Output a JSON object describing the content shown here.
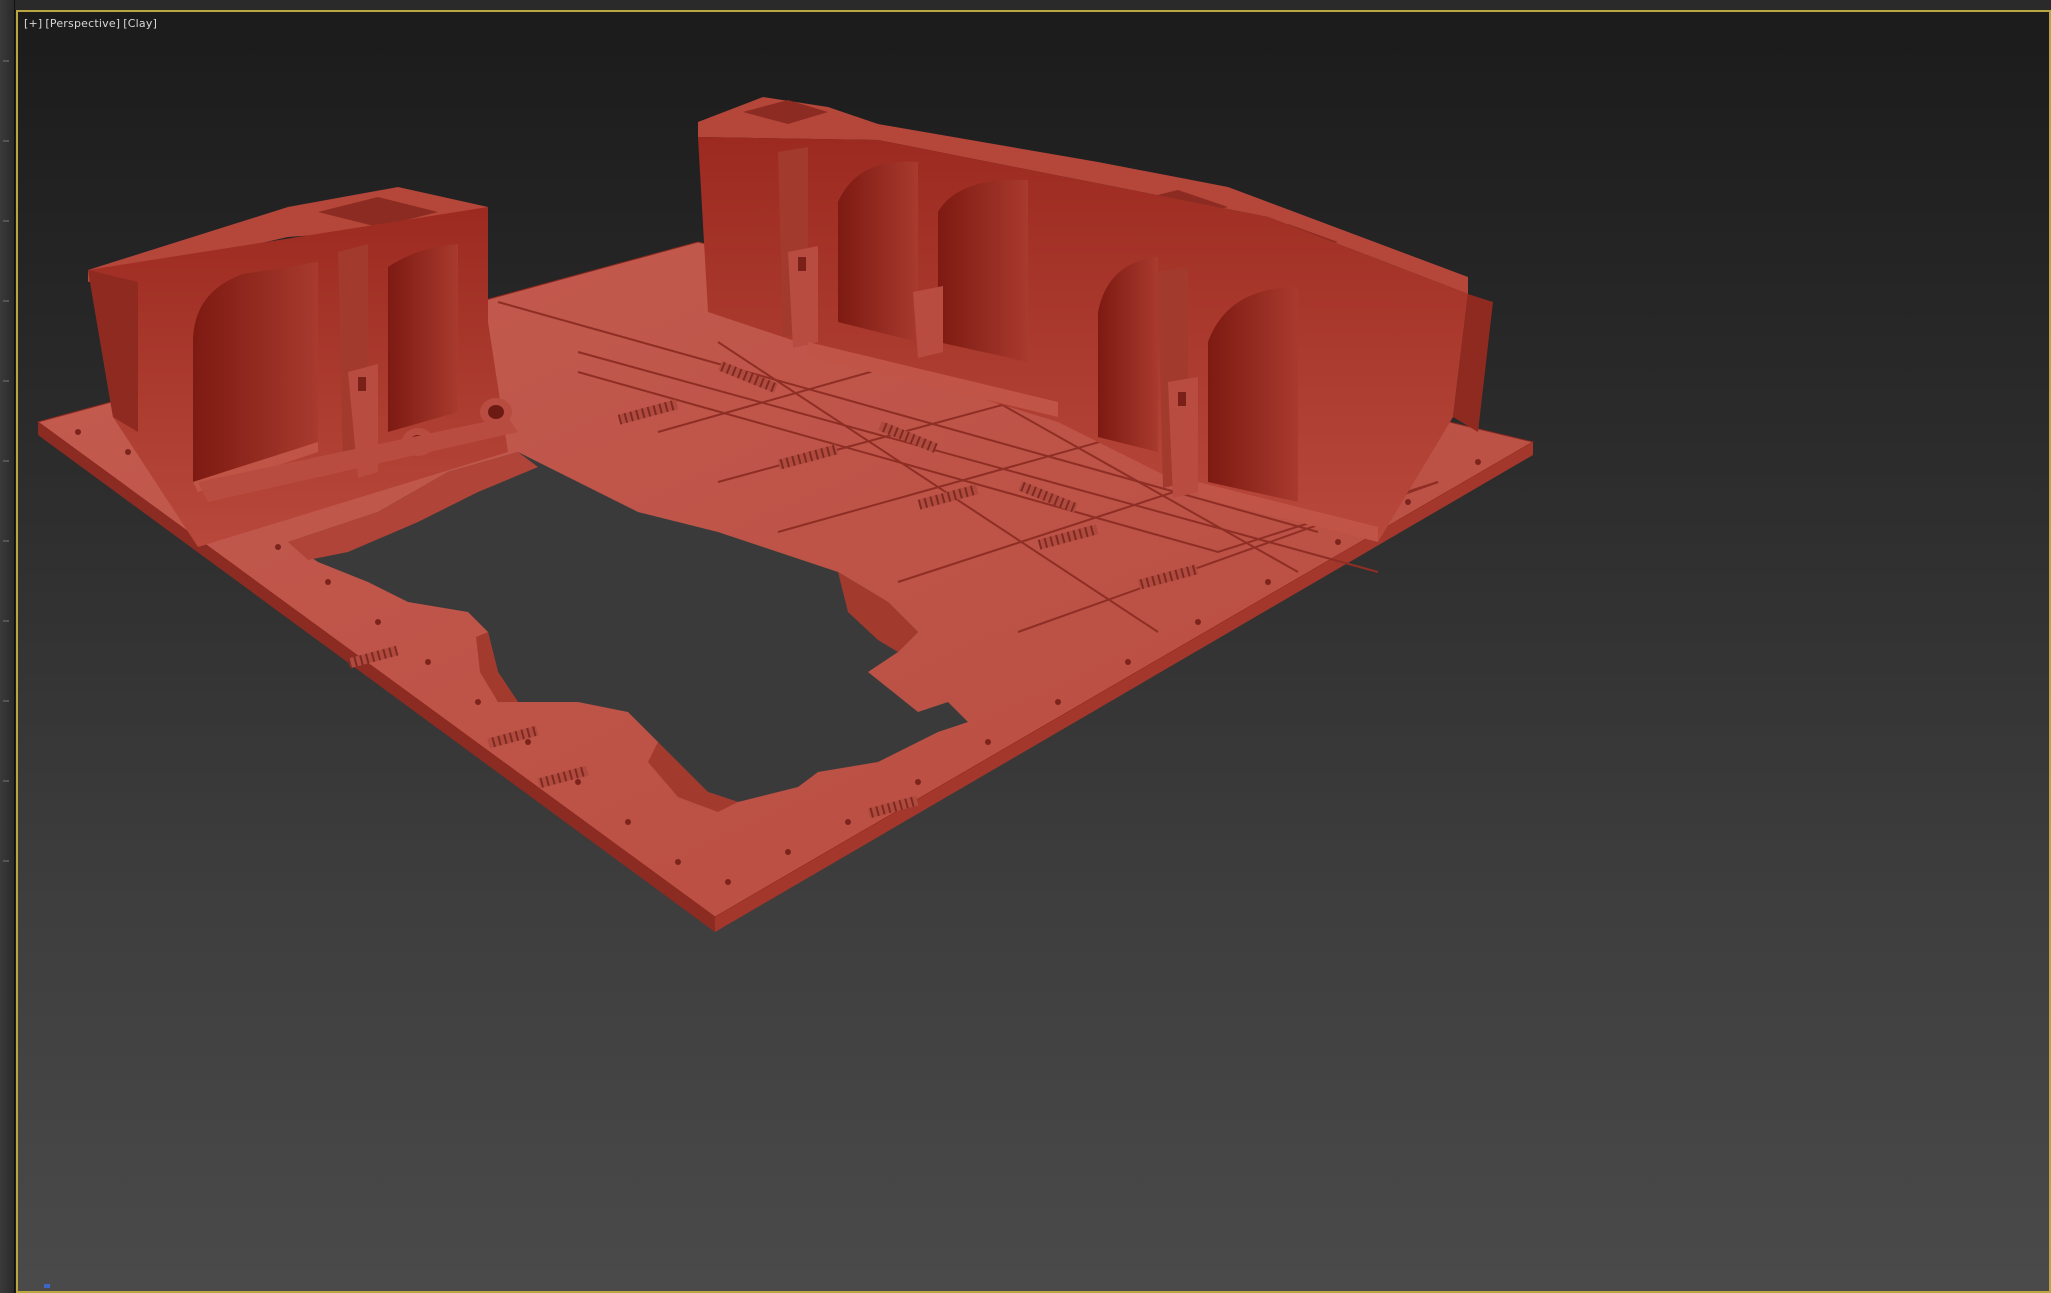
{
  "viewport": {
    "plus_label": "[+]",
    "view_label": "[Perspective]",
    "shading_label": "[Clay]"
  },
  "colors": {
    "active_border": "#b9a640",
    "clay_light": "#c65a4e",
    "clay_mid": "#a8392e",
    "clay_dark": "#7a1a14"
  },
  "icons": {
    "axis_marker": "axis-gizmo-icon"
  }
}
